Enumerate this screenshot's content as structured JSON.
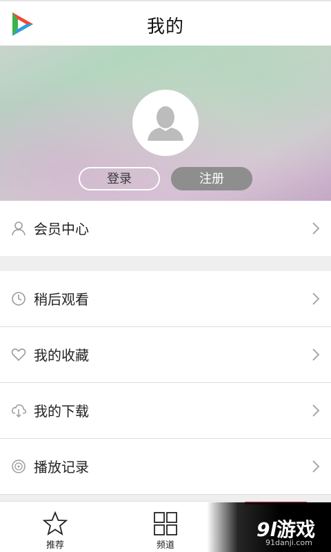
{
  "header": {
    "title": "我的"
  },
  "profile": {
    "login_label": "登录",
    "register_label": "注册"
  },
  "menu": {
    "member": {
      "label": "会员中心",
      "icon": "person-icon"
    },
    "items": [
      {
        "label": "稍后观看",
        "icon": "clock-icon"
      },
      {
        "label": "我的收藏",
        "icon": "heart-icon"
      },
      {
        "label": "我的下载",
        "icon": "cloud-download-icon"
      },
      {
        "label": "播放记录",
        "icon": "history-icon"
      }
    ]
  },
  "tabs": [
    {
      "label": "推荐",
      "icon": "star-icon"
    },
    {
      "label": "频道",
      "icon": "grid-icon"
    }
  ],
  "watermark": {
    "logo_num": "9l",
    "logo_text": "游戏",
    "url": "91danji.com"
  },
  "colors": {
    "accent": "#e8556a",
    "register_bg": "#8e8e8e"
  }
}
